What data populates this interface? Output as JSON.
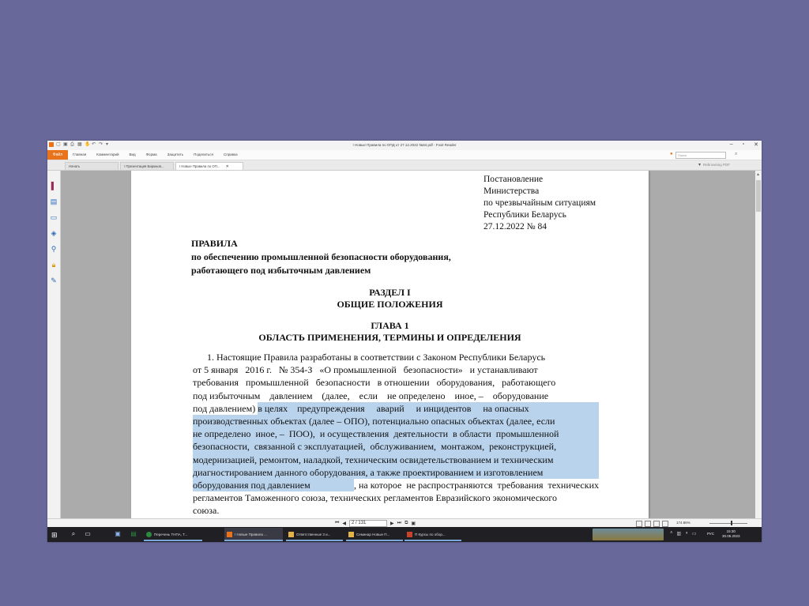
{
  "window": {
    "title": "! Новые Правила по ОПД от 27.12.2022 №84.pdf - Foxit Reader"
  },
  "quick_access": [
    "app-logo-icon",
    "open-icon",
    "save-icon",
    "print-icon",
    "screenshot-icon",
    "hand-icon",
    "undo-icon",
    "redo-icon",
    "customize-icon"
  ],
  "ribbon": {
    "file_tab": "Файл",
    "tabs": [
      "Главная",
      "Комментарий",
      "Вид",
      "Форма",
      "Защитить",
      "Поделиться",
      "Справка"
    ],
    "search_placeholder": "Поиск"
  },
  "doc_tabs": [
    {
      "label": "Начать",
      "active": false
    },
    {
      "label": "! Презентация Бирюков...",
      "active": false
    },
    {
      "label": "! Новые Правила по ОП...",
      "active": true
    }
  ],
  "doc_tabs_extra": "Rebrowsing PDF",
  "sidebar_icons": [
    "bookmarks-icon",
    "pages-icon",
    "comments-icon",
    "layers-icon",
    "attachments-icon",
    "security-icon",
    "signature-icon"
  ],
  "document": {
    "stamp": [
      "Постановление",
      "Министерства",
      "по чрезвычайным ситуациям",
      "Республики Беларусь",
      "27.12.2022 № 84"
    ],
    "title": [
      "ПРАВИЛА",
      "по обеспечению промышленной безопасности оборудования,",
      "работающего под избыточным давлением"
    ],
    "section": [
      "РАЗДЕЛ I",
      "ОБЩИЕ ПОЛОЖЕНИЯ"
    ],
    "chapter": [
      "ГЛАВА 1",
      "ОБЛАСТЬ ПРИМЕНЕНИЯ, ТЕРМИНЫ И ОПРЕДЕЛЕНИЯ"
    ],
    "paragraph_lines": [
      {
        "plain": "1. Настоящие Правила разработаны в соответствии с Законом Республики Беларусь",
        "hl": "",
        "after": ""
      },
      {
        "plain": "от 5 января   2016 г.   № 354-З   «О промышленной   безопасности»   и устанавливают",
        "hl": "",
        "after": ""
      },
      {
        "plain": "требования   промышленной   безопасности   в отношении   оборудования,   работающего",
        "hl": "",
        "after": ""
      },
      {
        "plain": "под избыточным    давлением    (далее,    если    не определено    иное, –    оборудование",
        "hl": "",
        "after": ""
      },
      {
        "plain": "под давлением) ",
        "hl": "в целях    предупреждения     аварий     и инцидентов     на опасных",
        "after": ""
      },
      {
        "plain": "",
        "hl": "производственных объектах (далее – ОПО), потенциально опасных объектах (далее, если",
        "after": ""
      },
      {
        "plain": "",
        "hl": "не определено  иное, –  ПОО),  и осуществления  деятельности  в области  промышленной",
        "after": ""
      },
      {
        "plain": "",
        "hl": "безопасности,  связанной с эксплуатацией,  обслуживанием,  монтажом,  реконструкцией,",
        "after": ""
      },
      {
        "plain": "",
        "hl": "модернизацией, ремонтом, наладкой, техническим освидетельствованием и техническим",
        "after": ""
      },
      {
        "plain": "",
        "hl": "диагностированием данного оборудования, а также проектированием и изготовлением",
        "after": ""
      },
      {
        "plain": "",
        "hl": "оборудования под давлением",
        "after": ", на которое  не распространяются  требования  технических"
      },
      {
        "plain": "регламентов Таможенного союза, технических регламентов Евразийского экономического",
        "hl": "",
        "after": ""
      },
      {
        "plain": "союза.",
        "hl": "",
        "after": ""
      }
    ]
  },
  "statusbar": {
    "page_indicator": "2 / 131",
    "zoom": "174.86%"
  },
  "taskbar": {
    "tasks": [
      {
        "label": "Перечень ТНПА, Т...",
        "color": "#2a8a3e",
        "active": false
      },
      {
        "label": "! Новые Правила ...",
        "color": "#e8731a",
        "active": true
      },
      {
        "label": "Ответственные 3 и...",
        "color": "#e3b34a",
        "active": false
      },
      {
        "label": "Семинар Новые П...",
        "color": "#e3b34a",
        "active": false
      },
      {
        "label": "П Курсы  по обор...",
        "color": "#c9432b",
        "active": false
      }
    ],
    "language": "РУС",
    "time": "15:30",
    "date": "30.05.2023"
  }
}
